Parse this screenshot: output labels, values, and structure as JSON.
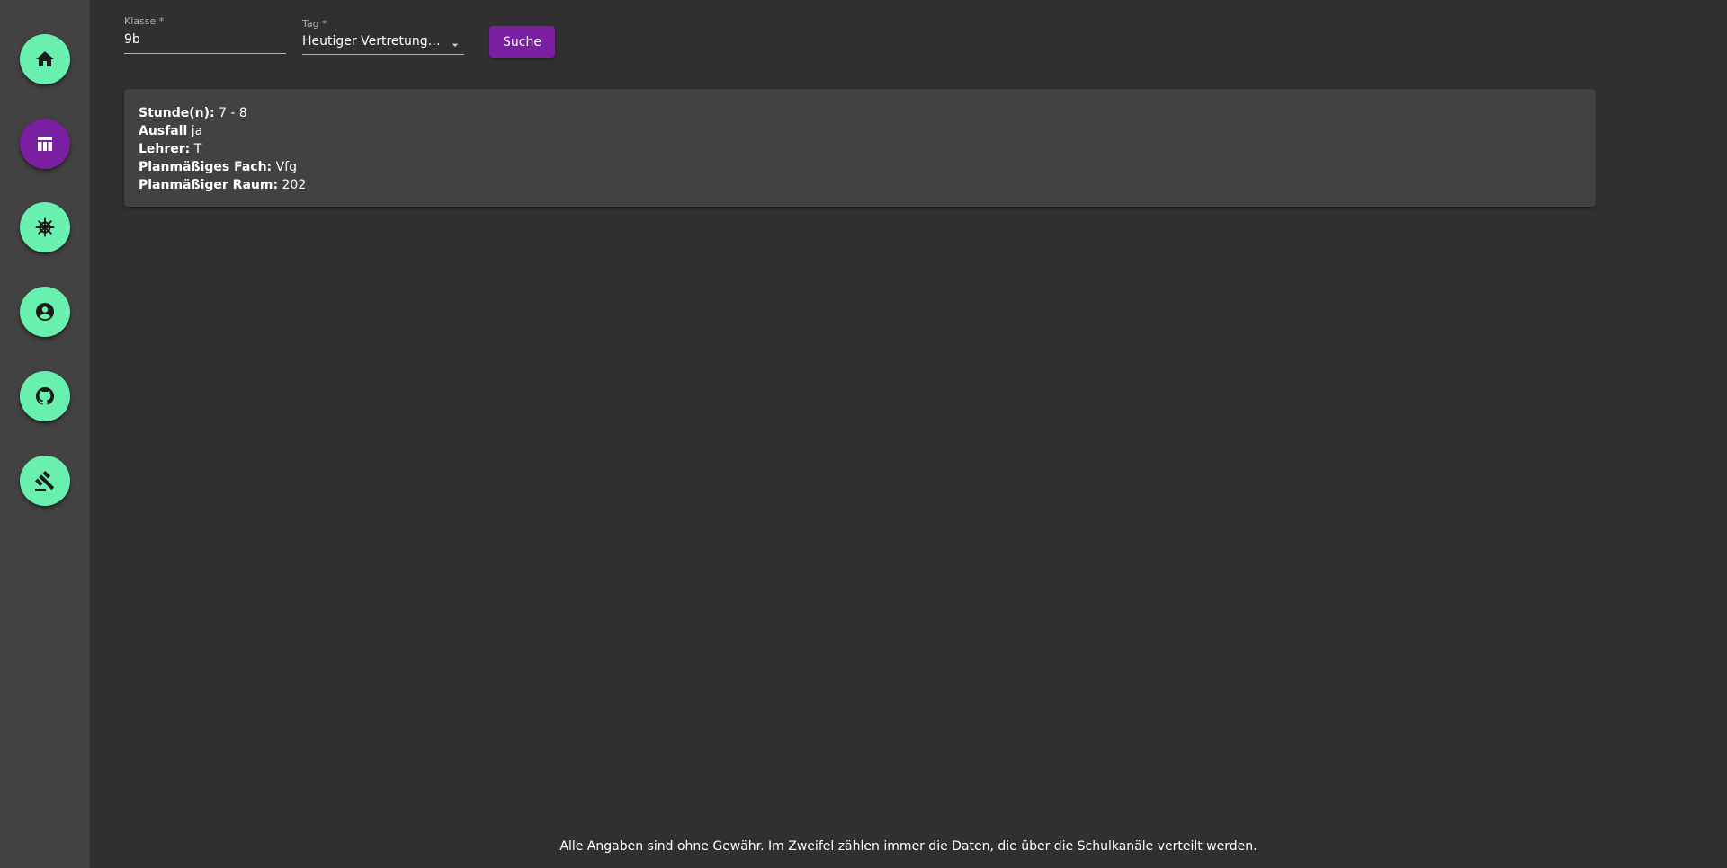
{
  "nav": [
    {
      "icon": "home-icon",
      "active": false
    },
    {
      "icon": "table-icon",
      "active": true
    },
    {
      "icon": "helm-icon",
      "active": false
    },
    {
      "icon": "account-circle-icon",
      "active": false
    },
    {
      "icon": "github-icon",
      "active": false
    },
    {
      "icon": "gavel-icon",
      "active": false
    }
  ],
  "form": {
    "klasse_label": "Klasse *",
    "klasse_value": "9b",
    "tag_label": "Tag *",
    "tag_value": "Heutiger Vertretungsplan",
    "search_label": "Suche"
  },
  "result": {
    "stunden_key": "Stunde(n):",
    "stunden_value": " 7 - 8",
    "ausfall_key": "Ausfall",
    "ausfall_value": " ja",
    "lehrer_key": "Lehrer:",
    "lehrer_value": " T",
    "fach_key": "Planmäßiges Fach:",
    "fach_value": " Vfg",
    "raum_key": "Planmäßiger Raum:",
    "raum_value": " 202"
  },
  "footer": "Alle Angaben sind ohne Gewähr. Im Zweifel zählen immer die Daten, die über die Schulkanäle verteilt werden.",
  "colors": {
    "background": "#303030",
    "sidebar": "#424242",
    "nav_button": "#69f0ae",
    "accent": "#7b1fa2",
    "card": "#424242"
  }
}
